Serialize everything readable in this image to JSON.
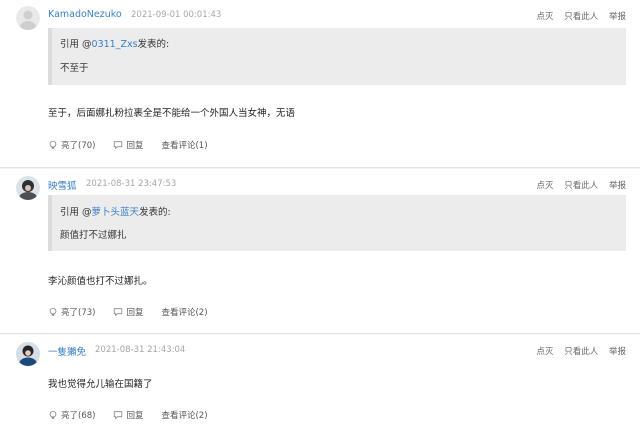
{
  "comments": [
    {
      "username": "KamadoNezuko",
      "timestamp": "2021-09-01 00:01:43",
      "actions": [
        "点灭",
        "只看此人",
        "举报"
      ],
      "quote": {
        "prefix": "引用 @",
        "author": "0311_Zxs",
        "suffix": "发表的:",
        "text": "不至于"
      },
      "body": "至于，后面娜扎粉拉裹全是不能给一个外国人当女神，无语",
      "footer": {
        "like": "亮了(70)",
        "reply": "回复",
        "view": "查看评论(1)"
      }
    },
    {
      "username": "映雪狐",
      "timestamp": "2021-08-31 23:47:53",
      "actions": [
        "点灭",
        "只看此人",
        "举报"
      ],
      "quote": {
        "prefix": "引用 @",
        "author": "萝卜头蓝天",
        "suffix": "发表的:",
        "text": "颜值打不过娜扎"
      },
      "body": "李沁颜值也打不过娜扎。",
      "footer": {
        "like": "亮了(73)",
        "reply": "回复",
        "view": "查看评论(2)"
      }
    },
    {
      "username": "一隻獺免",
      "timestamp": "2021-08-31 21:43:04",
      "actions": [
        "点灭",
        "只看此人",
        "举报"
      ],
      "body": "我也觉得允儿输在国籍了",
      "footer": {
        "like": "亮了(68)",
        "reply": "回复",
        "view": "查看评论(2)"
      }
    }
  ],
  "colors": {
    "username": "#3b7fc4",
    "quote_bg": "#ececec",
    "page_bg": "#f6f6f6"
  }
}
